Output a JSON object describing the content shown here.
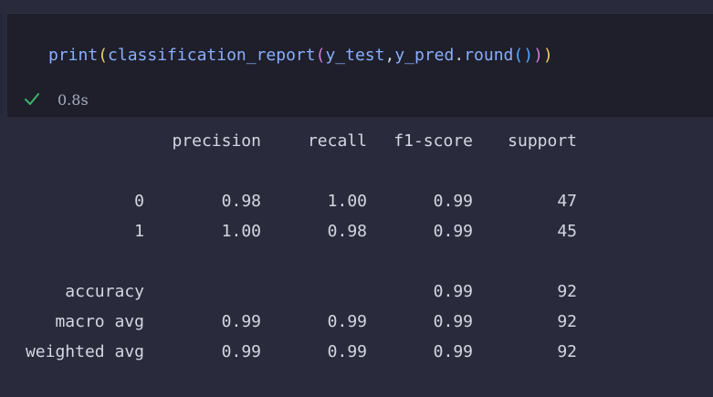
{
  "cell": {
    "code": {
      "fn_print": "print",
      "open1": "(",
      "fn_report": "classification_report",
      "open2": "(",
      "arg1": "y_test",
      "comma": ",",
      "arg2": "y_pred",
      "dot": ".",
      "method": "round",
      "open3": "(",
      "close3": ")",
      "close2": ")",
      "close1": ")"
    },
    "status_time": "0.8s",
    "status_icon": "check-icon",
    "status_color": "#3fb36b"
  },
  "report": {
    "headers": [
      "precision",
      "recall",
      "f1-score",
      "support"
    ],
    "rows": [
      {
        "label": "0",
        "precision": "0.98",
        "recall": "1.00",
        "f1": "0.99",
        "support": "47"
      },
      {
        "label": "1",
        "precision": "1.00",
        "recall": "0.98",
        "f1": "0.99",
        "support": "45"
      },
      {
        "label": "accuracy",
        "precision": "",
        "recall": "",
        "f1": "0.99",
        "support": "92"
      },
      {
        "label": "macro avg",
        "precision": "0.99",
        "recall": "0.99",
        "f1": "0.99",
        "support": "92"
      },
      {
        "label": "weighted avg",
        "precision": "0.99",
        "recall": "0.99",
        "f1": "0.99",
        "support": "92"
      }
    ]
  }
}
